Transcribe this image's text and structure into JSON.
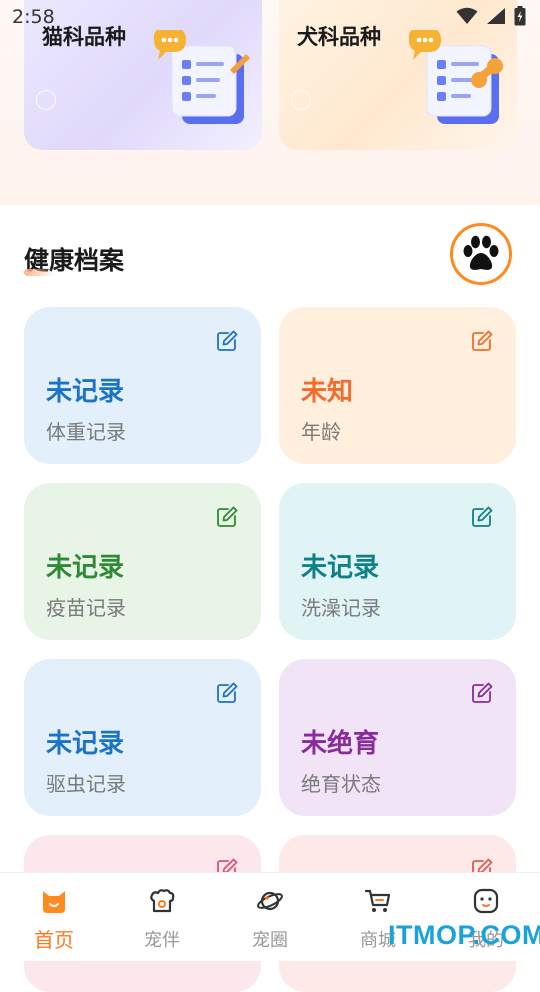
{
  "status_bar": {
    "time": "2:58"
  },
  "breeds": [
    {
      "title": "猫科品种"
    },
    {
      "title": "犬科品种"
    }
  ],
  "section": {
    "title": "健康档案"
  },
  "tiles": [
    {
      "value": "未记录",
      "label": "体重记录",
      "bg": "#e3f0fc",
      "color": "#1a73c8",
      "icon": "edit-icon"
    },
    {
      "value": "未知",
      "label": "年龄",
      "bg": "#ffefdc",
      "color": "#f36c2c",
      "icon": "edit-icon"
    },
    {
      "value": "未记录",
      "label": "疫苗记录",
      "bg": "#e8f4e6",
      "color": "#2e8b35",
      "icon": "edit-icon"
    },
    {
      "value": "未记录",
      "label": "洗澡记录",
      "bg": "#e0f4f6",
      "color": "#0e8088",
      "icon": "edit-icon"
    },
    {
      "value": "未记录",
      "label": "驱虫记录",
      "bg": "#e3f0fc",
      "color": "#1a73c8",
      "icon": "edit-icon"
    },
    {
      "value": "未绝育",
      "label": "绝育状态",
      "bg": "#f1e4f6",
      "color": "#8a2a9c",
      "icon": "edit-icon"
    },
    {
      "bg": "#fce7ec",
      "color": "#e0507a",
      "icon": "edit-icon"
    },
    {
      "bg": "#fdeae8",
      "color": "#e35a52",
      "icon": "edit-icon"
    }
  ],
  "tabs": [
    {
      "label": "首页",
      "icon": "home-cat-icon",
      "active": true
    },
    {
      "label": "宠伴",
      "icon": "pet-companion-icon"
    },
    {
      "label": "宠圈",
      "icon": "planet-icon"
    },
    {
      "label": "商城",
      "icon": "cart-icon"
    },
    {
      "label": "我的",
      "icon": "face-icon"
    }
  ],
  "watermark": "ITMOP.COM",
  "colors": {
    "accent": "#ff7a1a",
    "inactive": "#999999"
  }
}
